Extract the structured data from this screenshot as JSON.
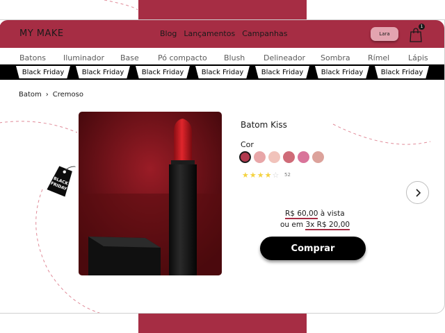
{
  "brand": {
    "logo": "MY MAKE",
    "accent": "#a62d44"
  },
  "nav": {
    "items": [
      "Blog",
      "Lançamentos",
      "Campanhas"
    ]
  },
  "user": {
    "name": "Lara"
  },
  "cart": {
    "count": "1",
    "icon": "shopping-bag-icon"
  },
  "categories": [
    "Batons",
    "Iluminador",
    "Base",
    "Pó compacto",
    "Blush",
    "Delineador",
    "Sombra",
    "Rímel",
    "Lápis"
  ],
  "promo": {
    "label": "Black Friday",
    "tag_line1": "BLACK",
    "tag_line2": "FRIDAY"
  },
  "breadcrumb": {
    "level1": "Batom",
    "separator": "›",
    "level2": "Cremoso"
  },
  "product": {
    "title": "Batom Kiss",
    "color_label": "Cor",
    "swatches": [
      "#b13a4e",
      "#e8a6a8",
      "#f1c3bb",
      "#cf6b78",
      "#d9749a",
      "#dca29b"
    ],
    "selected_swatch": 0,
    "rating": 4,
    "rating_max": 5,
    "review_count": "52",
    "price_cash": "R$ 60,00",
    "price_cash_suffix": "à vista",
    "price_install_prefix": "ou em",
    "price_install": "3x R$ 20,00",
    "buy_label": "Comprar"
  }
}
